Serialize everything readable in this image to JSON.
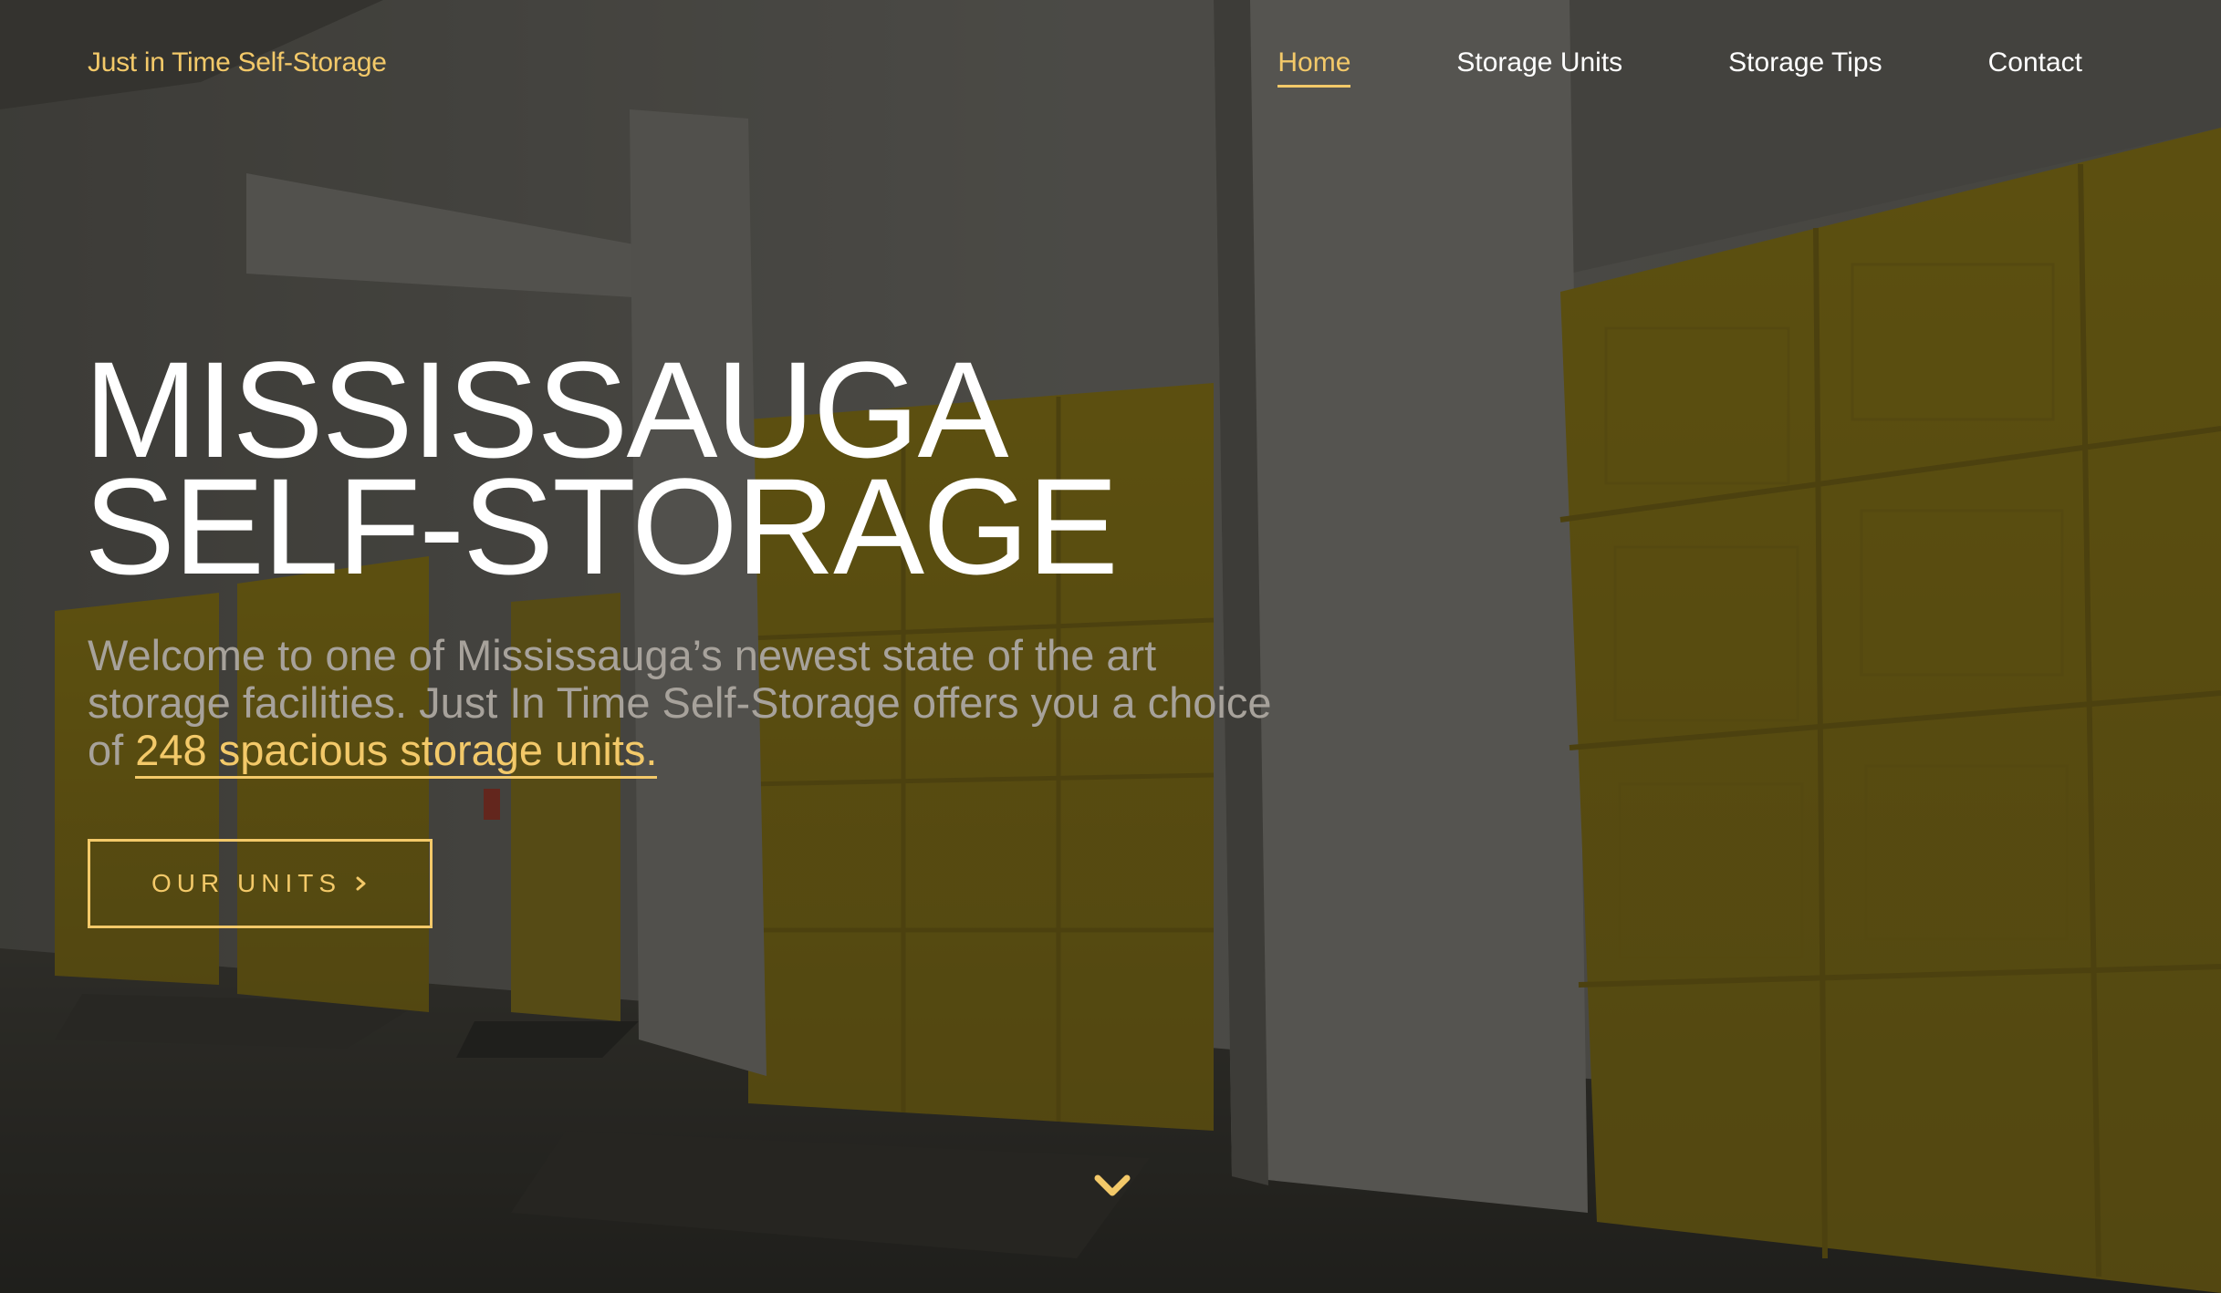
{
  "header": {
    "brand": "Just in Time Self-Storage",
    "nav": [
      {
        "label": "Home",
        "active": true
      },
      {
        "label": "Storage Units",
        "active": false
      },
      {
        "label": "Storage Tips",
        "active": false
      },
      {
        "label": "Contact",
        "active": false
      }
    ]
  },
  "hero": {
    "title_line1": "MISSISSAUGA",
    "title_line2": "SELF-STORAGE",
    "lead_text": "Welcome to one of Mississauga’s newest state of the art storage facilities. Just In Time Self-Storage offers you a choice of ",
    "lead_link": "248 spacious storage units.",
    "cta_label": "OUR UNITS",
    "cta_icon": "chevron-right-icon",
    "scroll_icon": "chevron-down-icon"
  },
  "colors": {
    "accent": "#f3c969",
    "text": "#ffffff",
    "lead": "#a7a29b",
    "overlay": "#161513"
  }
}
